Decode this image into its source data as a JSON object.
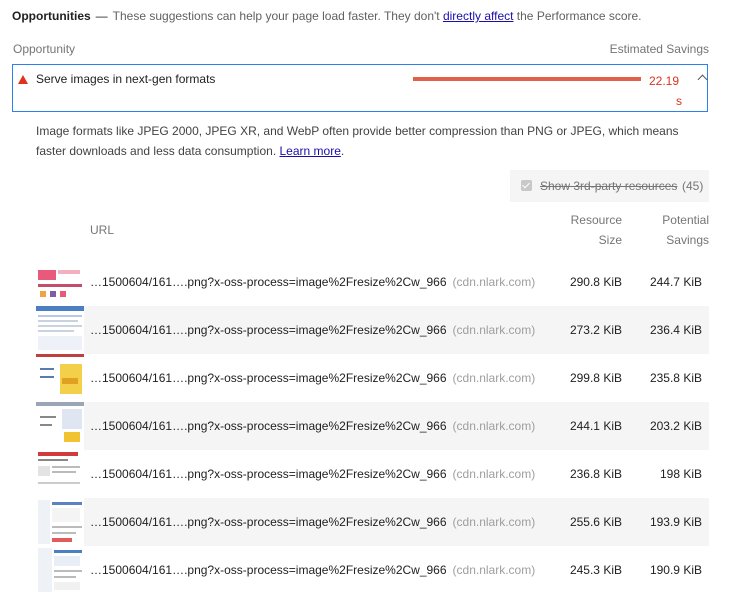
{
  "header": {
    "title": "Opportunities",
    "dash": "—",
    "description_pre": "These suggestions can help your page load faster. They don't",
    "link": "directly affect",
    "description_post": "the Performance score."
  },
  "columns": {
    "opportunity": "Opportunity",
    "estimated_savings": "Estimated Savings"
  },
  "opportunity": {
    "title": "Serve images in next-gen formats",
    "savings_value": "22.19",
    "savings_unit": "s",
    "bar_fill_fraction": 1.0,
    "status_color": "#e0321e",
    "expanded": true
  },
  "details": {
    "text": "Image formats like JPEG 2000, JPEG XR, and WebP often provide better compression than PNG or JPEG, which means faster downloads and less data consumption.",
    "learn_more": "Learn more",
    "period": "."
  },
  "third_party_toggle": {
    "label": "Show 3rd-party resources",
    "count": "(45)",
    "checked": true
  },
  "table": {
    "headers": {
      "url": "URL",
      "resource_size_line1": "Resource",
      "resource_size_line2": "Size",
      "potential_savings_line1": "Potential",
      "potential_savings_line2": "Savings"
    },
    "rows": [
      {
        "url": "…1500604/161….png?x-oss-process=image%2Fresize%2Cw_966",
        "host": "(cdn.nlark.com)",
        "size": "290.8 KiB",
        "savings": "244.7 KiB"
      },
      {
        "url": "…1500604/161….png?x-oss-process=image%2Fresize%2Cw_966",
        "host": "(cdn.nlark.com)",
        "size": "273.2 KiB",
        "savings": "236.4 KiB"
      },
      {
        "url": "…1500604/161….png?x-oss-process=image%2Fresize%2Cw_966",
        "host": "(cdn.nlark.com)",
        "size": "299.8 KiB",
        "savings": "235.8 KiB"
      },
      {
        "url": "…1500604/161….png?x-oss-process=image%2Fresize%2Cw_966",
        "host": "(cdn.nlark.com)",
        "size": "244.1 KiB",
        "savings": "203.2 KiB"
      },
      {
        "url": "…1500604/161….png?x-oss-process=image%2Fresize%2Cw_966",
        "host": "(cdn.nlark.com)",
        "size": "236.8 KiB",
        "savings": "198 KiB"
      },
      {
        "url": "…1500604/161….png?x-oss-process=image%2Fresize%2Cw_966",
        "host": "(cdn.nlark.com)",
        "size": "255.6 KiB",
        "savings": "193.9 KiB"
      },
      {
        "url": "…1500604/161….png?x-oss-process=image%2Fresize%2Cw_966",
        "host": "(cdn.nlark.com)",
        "size": "245.3 KiB",
        "savings": "190.9 KiB"
      }
    ]
  },
  "icons": {
    "warning": "warning-triangle-icon",
    "collapse": "chevron-up-icon",
    "checkbox": "checkbox-checked-icon"
  }
}
